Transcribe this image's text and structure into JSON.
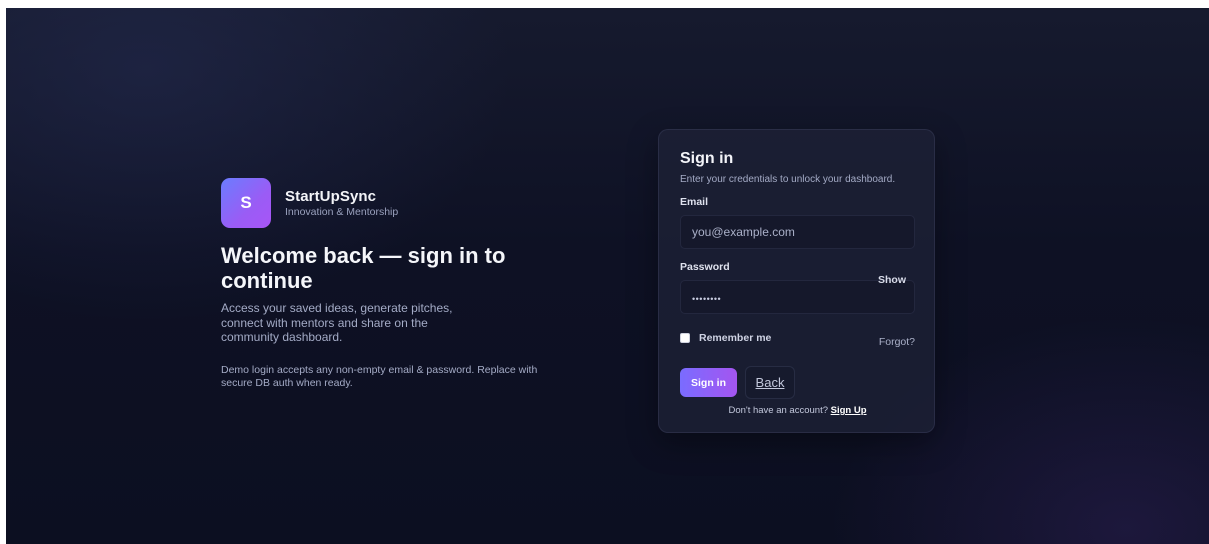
{
  "brand": {
    "logo_letter": "S",
    "name": "StartUpSync",
    "tagline": "Innovation & Mentorship"
  },
  "intro": {
    "headline": "Welcome back — sign in to continue",
    "subtext": "Access your saved ideas, generate pitches, connect with mentors and share on the community dashboard.",
    "demo_note": "Demo login accepts any non-empty email & password. Replace with secure DB auth when ready."
  },
  "signin": {
    "title": "Sign in",
    "subtitle": "Enter your credentials to unlock your dashboard.",
    "email_label": "Email",
    "email_placeholder": "you@example.com",
    "password_label": "Password",
    "password_value": "••••••••",
    "show_label": "Show",
    "remember_label": "Remember me",
    "forgot_label": "Forgot?",
    "submit_label": "Sign in",
    "back_label": "Back",
    "no_account_text": "Don't have an account?",
    "signup_label": "Sign Up"
  },
  "colors": {
    "accent_start": "#7a6cff",
    "accent_end": "#a455f0",
    "background": "#0e1124"
  }
}
